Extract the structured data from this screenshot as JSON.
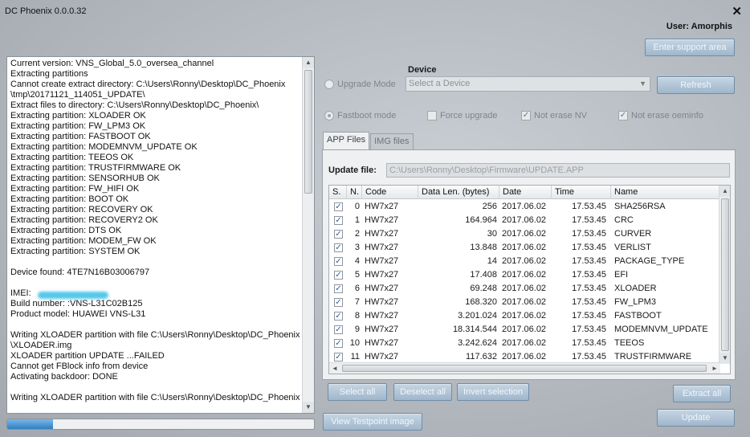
{
  "window": {
    "title": "DC Phoenix 0.0.0.32",
    "close_glyph": "✕",
    "user_label": "User: Amorphis"
  },
  "buttons": {
    "enter_support": "Enter support area",
    "refresh": "Refresh",
    "select_all": "Select all",
    "deselect_all": "Deselect all",
    "invert_selection": "Invert selection",
    "extract_all": "Extract all",
    "view_testpoint": "View Testpoint image",
    "update": "Update"
  },
  "device": {
    "label": "Device",
    "placeholder": "Select a Device",
    "upgrade_mode": "Upgrade Mode",
    "fastboot_mode": "Fastboot mode",
    "force_upgrade": "Force upgrade",
    "not_erase_nv": "Not erase NV",
    "not_erase_oeminfo": "Not erase oeminfo"
  },
  "tabs": [
    "APP Files",
    "IMG files"
  ],
  "update_file": {
    "label": "Update file:",
    "value": "C:\\Users\\Ronny\\Desktop\\Firmware\\UPDATE.APP"
  },
  "table": {
    "columns": [
      "S.",
      "N.",
      "Code",
      "Data Len. (bytes)",
      "Date",
      "Time",
      "Name"
    ],
    "rows": [
      {
        "n": "0",
        "code": "HW7x27",
        "len": "256",
        "date": "2017.06.02",
        "time": "17.53.45",
        "name": "SHA256RSA"
      },
      {
        "n": "1",
        "code": "HW7x27",
        "len": "164.964",
        "date": "2017.06.02",
        "time": "17.53.45",
        "name": "CRC"
      },
      {
        "n": "2",
        "code": "HW7x27",
        "len": "30",
        "date": "2017.06.02",
        "time": "17.53.45",
        "name": "CURVER"
      },
      {
        "n": "3",
        "code": "HW7x27",
        "len": "13.848",
        "date": "2017.06.02",
        "time": "17.53.45",
        "name": "VERLIST"
      },
      {
        "n": "4",
        "code": "HW7x27",
        "len": "14",
        "date": "2017.06.02",
        "time": "17.53.45",
        "name": "PACKAGE_TYPE"
      },
      {
        "n": "5",
        "code": "HW7x27",
        "len": "17.408",
        "date": "2017.06.02",
        "time": "17.53.45",
        "name": "EFI"
      },
      {
        "n": "6",
        "code": "HW7x27",
        "len": "69.248",
        "date": "2017.06.02",
        "time": "17.53.45",
        "name": "XLOADER"
      },
      {
        "n": "7",
        "code": "HW7x27",
        "len": "168.320",
        "date": "2017.06.02",
        "time": "17.53.45",
        "name": "FW_LPM3"
      },
      {
        "n": "8",
        "code": "HW7x27",
        "len": "3.201.024",
        "date": "2017.06.02",
        "time": "17.53.45",
        "name": "FASTBOOT"
      },
      {
        "n": "9",
        "code": "HW7x27",
        "len": "18.314.544",
        "date": "2017.06.02",
        "time": "17.53.45",
        "name": "MODEMNVM_UPDATE"
      },
      {
        "n": "10",
        "code": "HW7x27",
        "len": "3.242.624",
        "date": "2017.06.02",
        "time": "17.53.45",
        "name": "TEEOS"
      },
      {
        "n": "11",
        "code": "HW7x27",
        "len": "117.632",
        "date": "2017.06.02",
        "time": "17.53.45",
        "name": "TRUSTFIRMWARE"
      }
    ]
  },
  "log": [
    "Current version: VNS_Global_5.0_oversea_channel",
    "Extracting partitions",
    "Cannot create extract directory: C:\\Users\\Ronny\\Desktop\\DC_Phoenix",
    "\\tmp\\20171121_114051_UPDATE\\",
    "Extract files to directory: C:\\Users\\Ronny\\Desktop\\DC_Phoenix\\",
    "Extracting partition: XLOADER OK",
    "Extracting partition: FW_LPM3 OK",
    "Extracting partition: FASTBOOT OK",
    "Extracting partition: MODEMNVM_UPDATE OK",
    "Extracting partition: TEEOS OK",
    "Extracting partition: TRUSTFIRMWARE OK",
    "Extracting partition: SENSORHUB OK",
    "Extracting partition: FW_HIFI OK",
    "Extracting partition: BOOT OK",
    "Extracting partition: RECOVERY OK",
    "Extracting partition: RECOVERY2 OK",
    "Extracting partition: DTS OK",
    "Extracting partition: MODEM_FW OK",
    "Extracting partition: SYSTEM OK",
    "",
    "Device found: 4TE7N16B03006797",
    "",
    "IMEI:",
    "Build number: :VNS-L31C02B125",
    "Product model: HUAWEI VNS-L31",
    "",
    "Writing XLOADER partition with file C:\\Users\\Ronny\\Desktop\\DC_Phoenix",
    "\\XLOADER.img",
    "XLOADER partition UPDATE ...FAILED",
    "Cannot get FBlock info from device",
    "Activating backdoor: DONE",
    "",
    "Writing XLOADER partition with file C:\\Users\\Ronny\\Desktop\\DC_Phoenix"
  ],
  "progress": {
    "fraction": 0.15
  },
  "icons": {
    "check": "✓",
    "arrow_up": "▲",
    "arrow_down": "▼",
    "arrow_left": "◄",
    "arrow_right": "►",
    "dropdown": "▼"
  }
}
